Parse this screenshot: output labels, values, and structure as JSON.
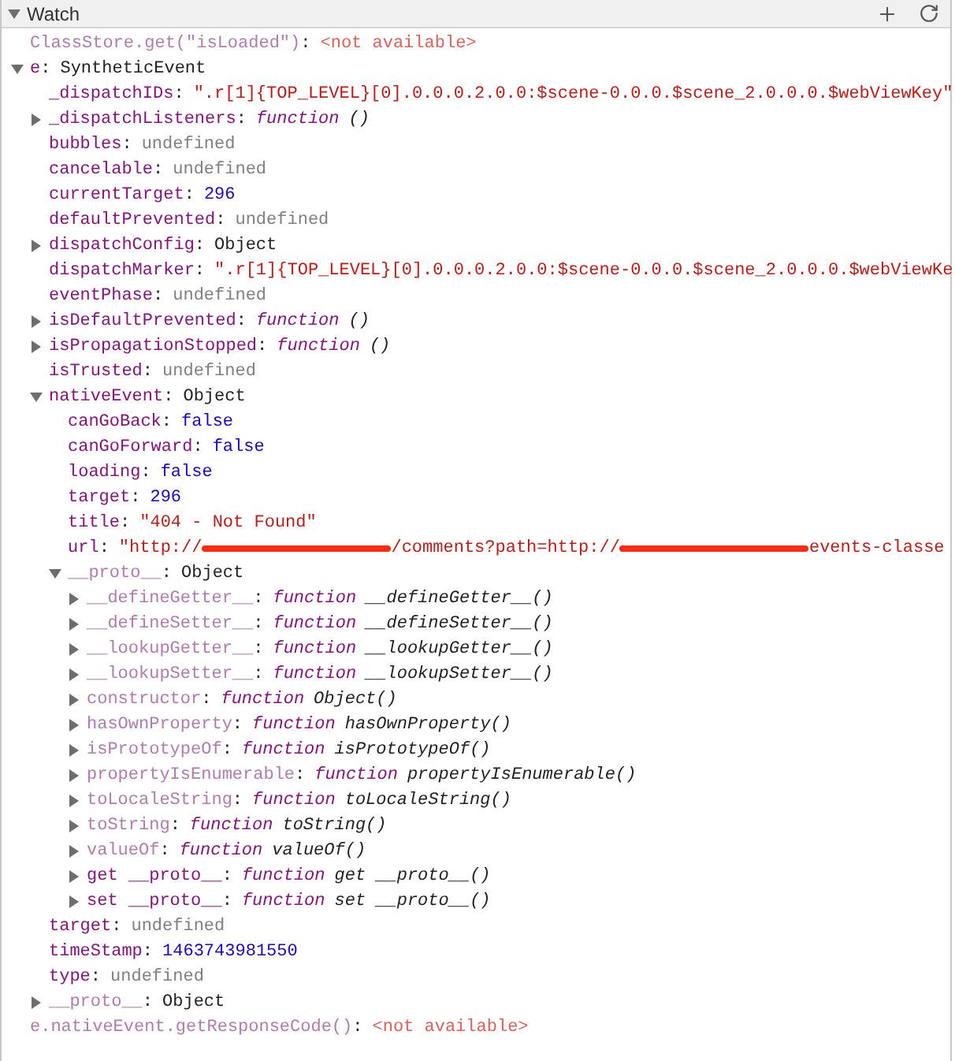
{
  "panel": {
    "title": "Watch",
    "expanded": true
  },
  "separator": ":",
  "watch_expressions": [
    {
      "name": "ClassStore.get(\"isLoaded\")",
      "value": "<not available>",
      "kind": "error",
      "dimmed": true
    },
    {
      "name": "e",
      "value": "SyntheticEvent",
      "kind": "object",
      "dimmed": false,
      "expanded": true,
      "children": [
        {
          "name": "_dispatchIDs",
          "value": "\".r[1]{TOP_LEVEL}[0].0.0.0.2.0.0:$scene-0.0.0.$scene_2.0.0.0.$webViewKey\"",
          "kind": "string",
          "dimmed": false
        },
        {
          "name": "_dispatchListeners",
          "value": "function",
          "signature": "()",
          "kind": "function",
          "dimmed": false,
          "expanded": false
        },
        {
          "name": "bubbles",
          "value": "undefined",
          "kind": "undefined",
          "dimmed": false
        },
        {
          "name": "cancelable",
          "value": "undefined",
          "kind": "undefined",
          "dimmed": false
        },
        {
          "name": "currentTarget",
          "value": "296",
          "kind": "number",
          "dimmed": false
        },
        {
          "name": "defaultPrevented",
          "value": "undefined",
          "kind": "undefined",
          "dimmed": false
        },
        {
          "name": "dispatchConfig",
          "value": "Object",
          "kind": "object",
          "dimmed": false,
          "expanded": false
        },
        {
          "name": "dispatchMarker",
          "value": "\".r[1]{TOP_LEVEL}[0].0.0.0.2.0.0:$scene-0.0.0.$scene_2.0.0.0.$webViewKe",
          "kind": "string",
          "dimmed": false
        },
        {
          "name": "eventPhase",
          "value": "undefined",
          "kind": "undefined",
          "dimmed": false
        },
        {
          "name": "isDefaultPrevented",
          "value": "function",
          "signature": "()",
          "kind": "function",
          "dimmed": false,
          "expanded": false
        },
        {
          "name": "isPropagationStopped",
          "value": "function",
          "signature": "()",
          "kind": "function",
          "dimmed": false,
          "expanded": false
        },
        {
          "name": "isTrusted",
          "value": "undefined",
          "kind": "undefined",
          "dimmed": false
        },
        {
          "name": "nativeEvent",
          "value": "Object",
          "kind": "object",
          "dimmed": false,
          "expanded": true,
          "children": [
            {
              "name": "canGoBack",
              "value": "false",
              "kind": "boolean",
              "dimmed": false
            },
            {
              "name": "canGoForward",
              "value": "false",
              "kind": "boolean",
              "dimmed": false
            },
            {
              "name": "loading",
              "value": "false",
              "kind": "boolean",
              "dimmed": false
            },
            {
              "name": "target",
              "value": "296",
              "kind": "number",
              "dimmed": false
            },
            {
              "name": "title",
              "value": "\"404 - Not Found\"",
              "kind": "string",
              "dimmed": false
            },
            {
              "name": "url",
              "kind": "string",
              "dimmed": false,
              "parts": [
                {
                  "kind": "text",
                  "text": "\"http://"
                },
                {
                  "kind": "redacted"
                },
                {
                  "kind": "text",
                  "text": "/comments?path=http://"
                },
                {
                  "kind": "redacted"
                },
                {
                  "kind": "text",
                  "text": "events-classe"
                }
              ]
            },
            {
              "name": "__proto__",
              "value": "Object",
              "kind": "object",
              "dimmed": true,
              "expanded": true,
              "children": [
                {
                  "name": "__defineGetter__",
                  "value": "function",
                  "signature": "__defineGetter__()",
                  "kind": "function",
                  "dimmed": true,
                  "expanded": false
                },
                {
                  "name": "__defineSetter__",
                  "value": "function",
                  "signature": "__defineSetter__()",
                  "kind": "function",
                  "dimmed": true,
                  "expanded": false
                },
                {
                  "name": "__lookupGetter__",
                  "value": "function",
                  "signature": "__lookupGetter__()",
                  "kind": "function",
                  "dimmed": true,
                  "expanded": false
                },
                {
                  "name": "__lookupSetter__",
                  "value": "function",
                  "signature": "__lookupSetter__()",
                  "kind": "function",
                  "dimmed": true,
                  "expanded": false
                },
                {
                  "name": "constructor",
                  "value": "function",
                  "signature": "Object()",
                  "kind": "function",
                  "dimmed": true,
                  "expanded": false
                },
                {
                  "name": "hasOwnProperty",
                  "value": "function",
                  "signature": "hasOwnProperty()",
                  "kind": "function",
                  "dimmed": true,
                  "expanded": false
                },
                {
                  "name": "isPrototypeOf",
                  "value": "function",
                  "signature": "isPrototypeOf()",
                  "kind": "function",
                  "dimmed": true,
                  "expanded": false
                },
                {
                  "name": "propertyIsEnumerable",
                  "value": "function",
                  "signature": "propertyIsEnumerable()",
                  "kind": "function",
                  "dimmed": true,
                  "expanded": false
                },
                {
                  "name": "toLocaleString",
                  "value": "function",
                  "signature": "toLocaleString()",
                  "kind": "function",
                  "dimmed": true,
                  "expanded": false
                },
                {
                  "name": "toString",
                  "value": "function",
                  "signature": "toString()",
                  "kind": "function",
                  "dimmed": true,
                  "expanded": false
                },
                {
                  "name": "valueOf",
                  "value": "function",
                  "signature": "valueOf()",
                  "kind": "function",
                  "dimmed": true,
                  "expanded": false
                },
                {
                  "name": "get __proto__",
                  "value": "function",
                  "signature": "get __proto__()",
                  "kind": "function",
                  "dimmed": false,
                  "expanded": false
                },
                {
                  "name": "set __proto__",
                  "value": "function",
                  "signature": "set __proto__()",
                  "kind": "function",
                  "dimmed": false,
                  "expanded": false
                }
              ]
            }
          ]
        },
        {
          "name": "target",
          "value": "undefined",
          "kind": "undefined",
          "dimmed": false
        },
        {
          "name": "timeStamp",
          "value": "1463743981550",
          "kind": "number",
          "dimmed": false
        },
        {
          "name": "type",
          "value": "undefined",
          "kind": "undefined",
          "dimmed": false
        },
        {
          "name": "__proto__",
          "value": "Object",
          "kind": "object",
          "dimmed": true,
          "expanded": false
        }
      ]
    },
    {
      "name": "e.nativeEvent.getResponseCode()",
      "value": "<not available>",
      "kind": "error",
      "dimmed": true
    }
  ]
}
